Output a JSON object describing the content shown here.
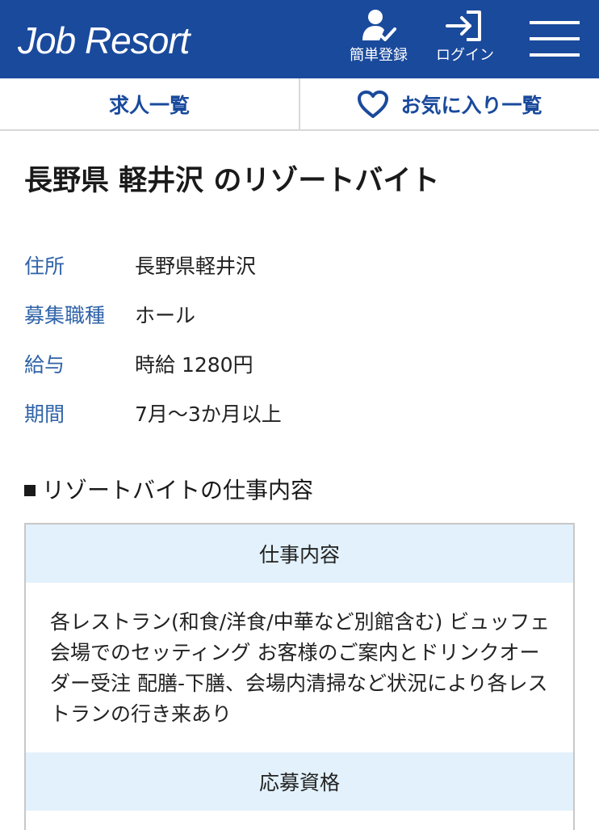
{
  "header": {
    "logo": "Job Resort",
    "register_label": "簡単登録",
    "login_label": "ログイン",
    "icons": {
      "register": "user-check-icon",
      "login": "login-arrow-icon",
      "menu": "hamburger-menu-icon"
    }
  },
  "tabs": [
    {
      "label": "求人一覧"
    },
    {
      "label": "お気に入り一覧",
      "icon": "heart-icon"
    }
  ],
  "page": {
    "title": "長野県 軽井沢 のリゾートバイト"
  },
  "info": [
    {
      "key": "住所",
      "value": "長野県軽井沢"
    },
    {
      "key": "募集職種",
      "value": "ホール"
    },
    {
      "key": "給与",
      "value": "時給 1280円"
    },
    {
      "key": "期間",
      "value": "7月〜3か月以上"
    }
  ],
  "section": {
    "heading": "リゾートバイトの仕事内容"
  },
  "job_table": [
    {
      "header": "仕事内容",
      "body": "各レストラン(和食/洋食/中華など別館含む) ビュッフェ会場でのセッティング お客様のご案内とドリンクオーダー受注 配膳-下膳、会場内清掃など状況により各レストランの行き来あり"
    },
    {
      "header": "応募資格"
    }
  ],
  "colors": {
    "brand": "#1a4a9c",
    "label": "#2f63a8",
    "table_header_bg": "#e2f1fb"
  }
}
